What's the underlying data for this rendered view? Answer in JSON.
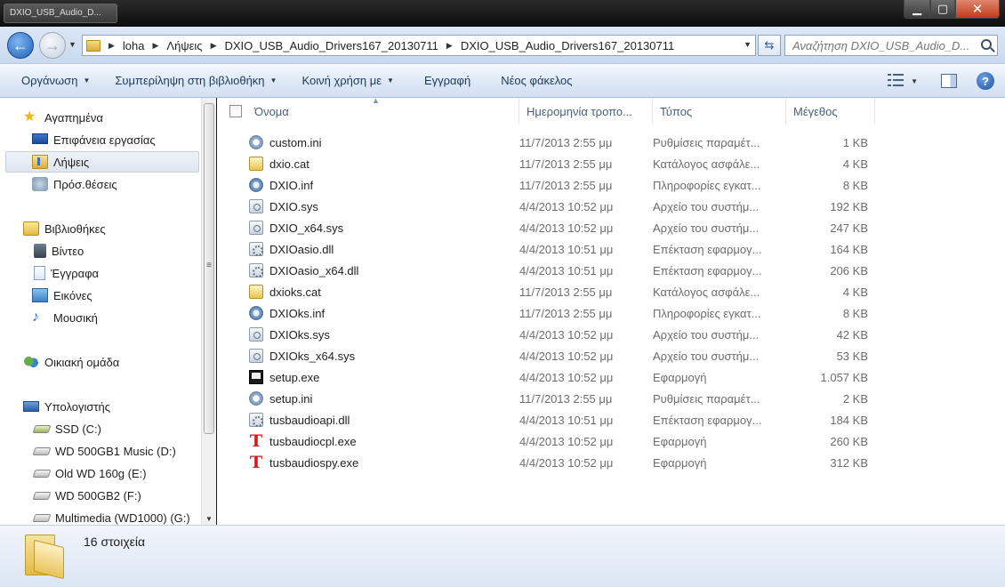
{
  "window": {
    "ghost_tab": "DXIO_USB_Audio_D..."
  },
  "address": {
    "crumbs": [
      "loha",
      "Λήψεις",
      "DXIO_USB_Audio_Drivers167_20130711",
      "DXIO_USB_Audio_Drivers167_20130711"
    ],
    "search_placeholder": "Αναζήτηση DXIO_USB_Audio_D..."
  },
  "toolbar": {
    "organize": "Οργάνωση",
    "include_library": "Συμπερίληψη στη βιβλιοθήκη",
    "share": "Κοινή χρήση με",
    "burn": "Εγγραφή",
    "new_folder": "Νέος φάκελος"
  },
  "nav": {
    "favorites": "Αγαπημένα",
    "desktop": "Επιφάνεια εργασίας",
    "downloads": "Λήψεις",
    "recent": "Πρόσ.θέσεις",
    "libraries": "Βιβλιοθήκες",
    "videos": "Βίντεο",
    "documents": "Έγγραφα",
    "pictures": "Εικόνες",
    "music": "Μουσική",
    "homegroup": "Οικιακή ομάδα",
    "computer": "Υπολογιστής",
    "drives": [
      "SSD (C:)",
      "WD 500GB1 Music (D:)",
      "Old WD 160g (E:)",
      "WD 500GB2 (F:)",
      "Multimedia (WD1000) (G:)"
    ]
  },
  "columns": {
    "name": "Όνομα",
    "date": "Ημερομηνία τροπο...",
    "type": "Τύπος",
    "size": "Μέγεθος"
  },
  "files": [
    {
      "name": "custom.ini",
      "date": "11/7/2013 2:55 μμ",
      "type": "Ρυθμίσεις παραμέτ...",
      "size": "1 KB",
      "icon": "config-file-icon"
    },
    {
      "name": "dxio.cat",
      "date": "11/7/2013 2:55 μμ",
      "type": "Κατάλογος ασφάλε...",
      "size": "4 KB",
      "icon": "catalog-file-icon"
    },
    {
      "name": "DXIO.inf",
      "date": "11/7/2013 2:55 μμ",
      "type": "Πληροφορίες εγκατ...",
      "size": "8 KB",
      "icon": "setup-info-icon"
    },
    {
      "name": "DXIO.sys",
      "date": "4/4/2013 10:52 μμ",
      "type": "Αρχείο του συστήμ...",
      "size": "192 KB",
      "icon": "system-file-icon"
    },
    {
      "name": "DXIO_x64.sys",
      "date": "4/4/2013 10:52 μμ",
      "type": "Αρχείο του συστήμ...",
      "size": "247 KB",
      "icon": "system-file-icon"
    },
    {
      "name": "DXIOasio.dll",
      "date": "4/4/2013 10:51 μμ",
      "type": "Επέκταση εφαρμογ...",
      "size": "164 KB",
      "icon": "dll-file-icon"
    },
    {
      "name": "DXIOasio_x64.dll",
      "date": "4/4/2013 10:51 μμ",
      "type": "Επέκταση εφαρμογ...",
      "size": "206 KB",
      "icon": "dll-file-icon"
    },
    {
      "name": "dxioks.cat",
      "date": "11/7/2013 2:55 μμ",
      "type": "Κατάλογος ασφάλε...",
      "size": "4 KB",
      "icon": "catalog-file-icon"
    },
    {
      "name": "DXIOks.inf",
      "date": "11/7/2013 2:55 μμ",
      "type": "Πληροφορίες εγκατ...",
      "size": "8 KB",
      "icon": "setup-info-icon"
    },
    {
      "name": "DXIOks.sys",
      "date": "4/4/2013 10:52 μμ",
      "type": "Αρχείο του συστήμ...",
      "size": "42 KB",
      "icon": "system-file-icon"
    },
    {
      "name": "DXIOks_x64.sys",
      "date": "4/4/2013 10:52 μμ",
      "type": "Αρχείο του συστήμ...",
      "size": "53 KB",
      "icon": "system-file-icon"
    },
    {
      "name": "setup.exe",
      "date": "4/4/2013 10:52 μμ",
      "type": "Εφαρμογή",
      "size": "1.057 KB",
      "icon": "exe-file-icon"
    },
    {
      "name": "setup.ini",
      "date": "11/7/2013 2:55 μμ",
      "type": "Ρυθμίσεις παραμέτ...",
      "size": "2 KB",
      "icon": "config-file-icon"
    },
    {
      "name": "tusbaudioapi.dll",
      "date": "4/4/2013 10:51 μμ",
      "type": "Επέκταση εφαρμογ...",
      "size": "184 KB",
      "icon": "dll-file-icon"
    },
    {
      "name": "tusbaudiocpl.exe",
      "date": "4/4/2013 10:52 μμ",
      "type": "Εφαρμογή",
      "size": "260 KB",
      "icon": "tusb-app-icon"
    },
    {
      "name": "tusbaudiospy.exe",
      "date": "4/4/2013 10:52 μμ",
      "type": "Εφαρμογή",
      "size": "312 KB",
      "icon": "tusb-app-icon"
    }
  ],
  "status": {
    "count": "16 στοιχεία"
  }
}
